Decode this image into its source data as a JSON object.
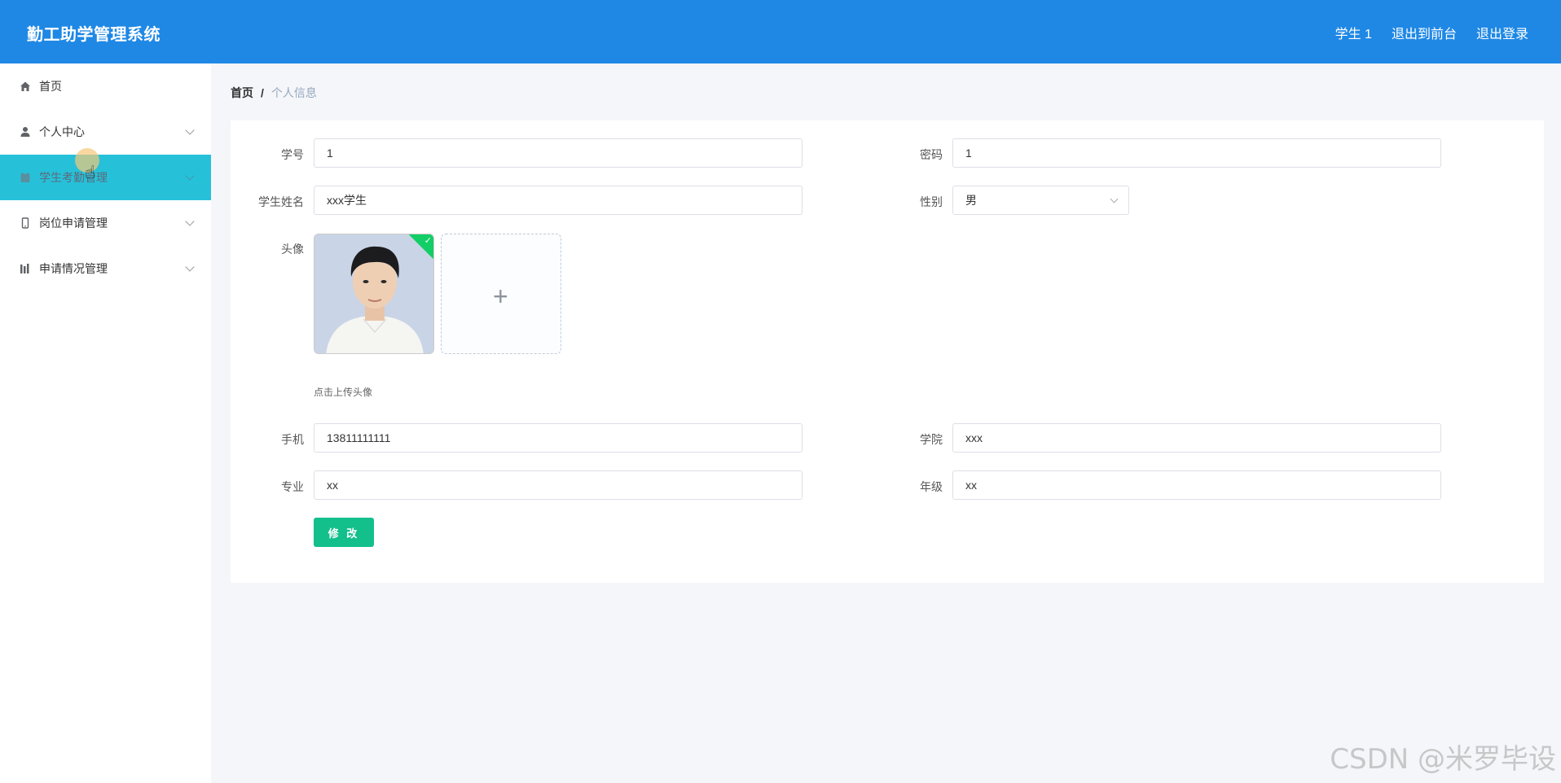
{
  "header": {
    "brand": "勤工助学管理系统",
    "user": "学生 1",
    "to_front": "退出到前台",
    "logout": "退出登录"
  },
  "sidebar": {
    "items": [
      {
        "label": "首页",
        "icon": "home-icon"
      },
      {
        "label": "个人中心",
        "icon": "user-icon"
      },
      {
        "label": "学生考勤管理",
        "icon": "calendar-icon"
      },
      {
        "label": "岗位申请管理",
        "icon": "mobile-icon"
      },
      {
        "label": "申请情况管理",
        "icon": "chart-icon"
      }
    ]
  },
  "breadcrumb": {
    "home": "首页",
    "separator": "/",
    "current": "个人信息"
  },
  "form": {
    "student_id_label": "学号",
    "student_id_value": "1",
    "password_label": "密码",
    "password_value": "1",
    "name_label": "学生姓名",
    "name_value": "xxx学生",
    "gender_label": "性别",
    "gender_value": "男",
    "avatar_label": "头像",
    "avatar_hint": "点击上传头像",
    "phone_label": "手机",
    "phone_value": "13811111111",
    "college_label": "学院",
    "college_value": "xxx",
    "major_label": "专业",
    "major_value": "xx",
    "grade_label": "年级",
    "grade_value": "xx",
    "submit_label": "修 改"
  },
  "watermark": "CSDN @米罗毕设",
  "colors": {
    "header_bg": "#1f88e5",
    "active_menu_bg": "#26c1d9",
    "submit_bg": "#13bf8b",
    "upload_success": "#13ce66"
  }
}
